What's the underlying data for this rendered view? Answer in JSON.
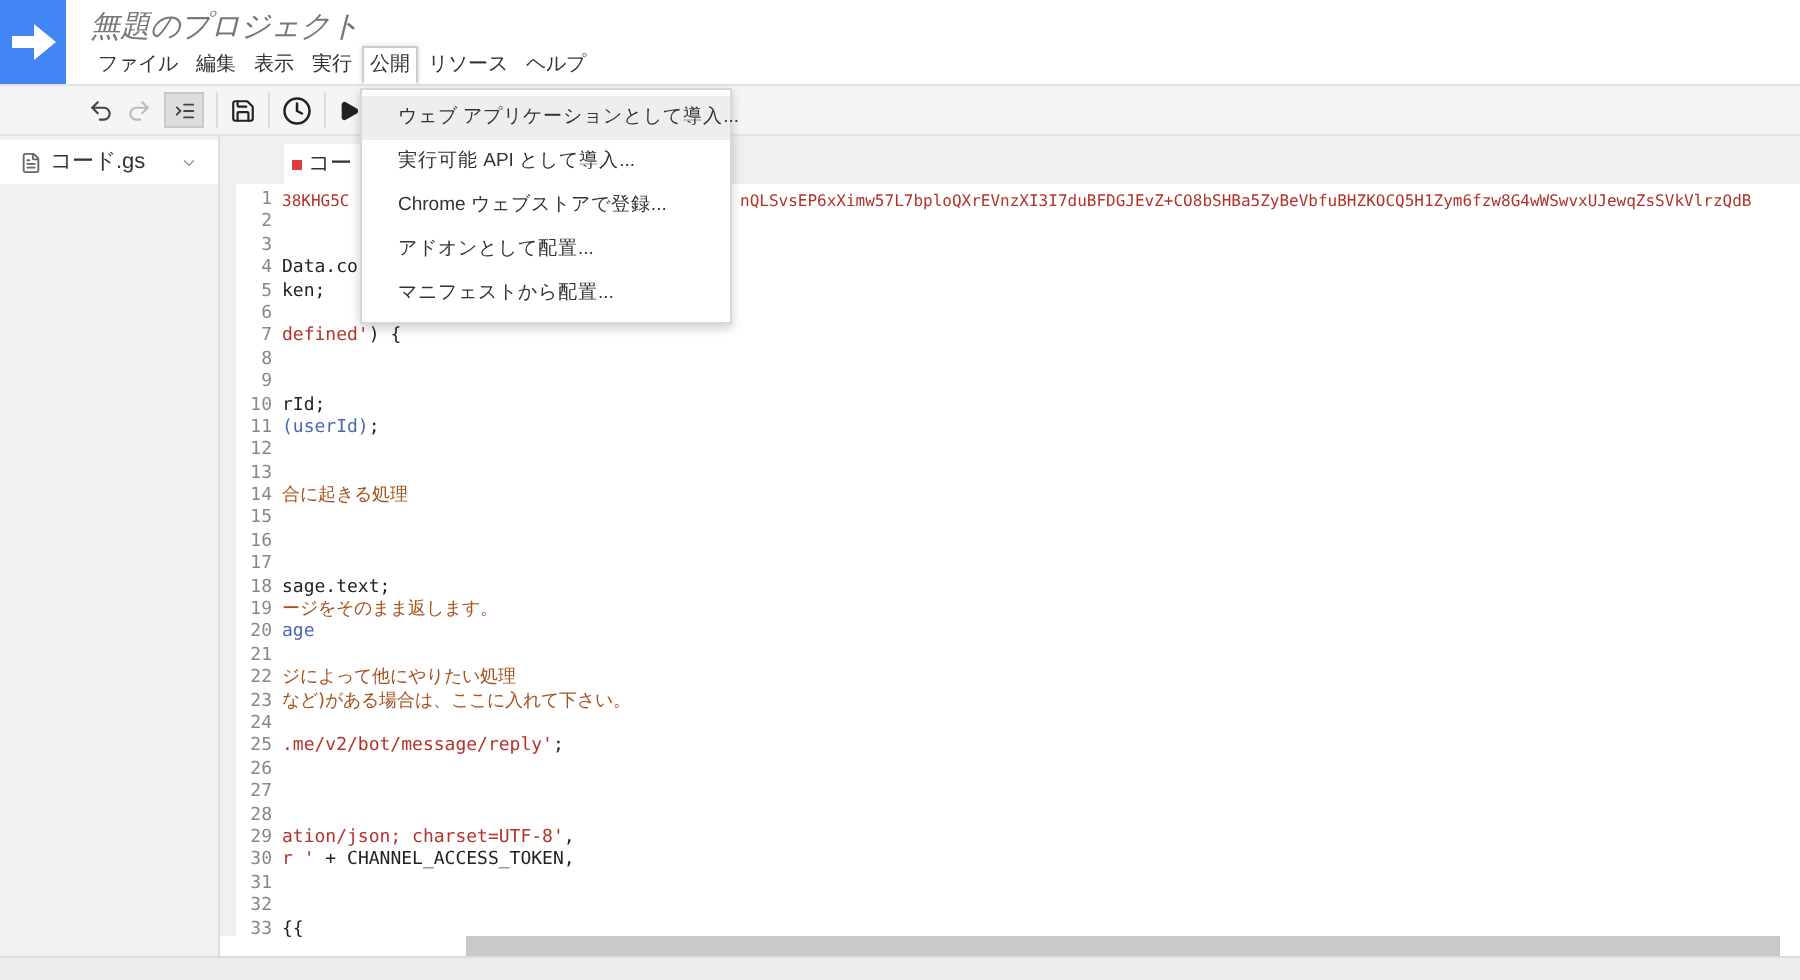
{
  "project": {
    "title": "無題のプロジェクト"
  },
  "menubar": [
    {
      "label": "ファイル",
      "selected": false
    },
    {
      "label": "編集",
      "selected": false
    },
    {
      "label": "表示",
      "selected": false
    },
    {
      "label": "実行",
      "selected": false
    },
    {
      "label": "公開",
      "selected": true
    },
    {
      "label": "リソース",
      "selected": false
    },
    {
      "label": "ヘルプ",
      "selected": false
    }
  ],
  "menu": [
    {
      "label": "ウェブ アプリケーションとして導入...",
      "selected": true
    },
    {
      "label": "実行可能 API として導入...",
      "selected": false
    },
    {
      "label": "Chrome ウェブストアで登録...",
      "selected": false
    },
    {
      "label": "アドオンとして配置...",
      "selected": false
    },
    {
      "label": "マニフェストから配置...",
      "selected": false
    }
  ],
  "sidebar": {
    "items": [
      {
        "label": "コード.gs",
        "selected": true
      }
    ]
  },
  "tab": {
    "label": "コー",
    "unsaved": true
  },
  "code": [
    {
      "number": "1",
      "segments": [
        {
          "text": "38KHG5C",
          "kind": "string"
        }
      ],
      "after_menu": [
        {
          "text": "nQLSvsEP6xXimw57L7bploQXrEVnzXI3I7duBFDGJEvZ+CO8bSHBa5ZyBeVbfuBHZKOCQ5H1Zym6fzw8G4wWSwvxUJewqZsSVkVlrzQdB",
          "kind": "string"
        }
      ]
    },
    {
      "number": "2"
    },
    {
      "number": "3"
    },
    {
      "number": "4",
      "segments": [
        {
          "text": "Data.co",
          "kind": "plain"
        }
      ]
    },
    {
      "number": "5",
      "segments": [
        {
          "text": "ken;",
          "kind": "plain"
        }
      ]
    },
    {
      "number": "6"
    },
    {
      "number": "7",
      "segments": [
        {
          "text": "defined'",
          "kind": "string"
        },
        {
          "text": ") {",
          "kind": "plain"
        }
      ]
    },
    {
      "number": "8"
    },
    {
      "number": "9"
    },
    {
      "number": "10",
      "segments": [
        {
          "text": "rId;",
          "kind": "plain"
        }
      ]
    },
    {
      "number": "11",
      "segments": [
        {
          "text": "(userId)",
          "kind": "variable"
        },
        {
          "text": ";",
          "kind": "plain"
        }
      ]
    },
    {
      "number": "12"
    },
    {
      "number": "13"
    },
    {
      "number": "14",
      "segments": [
        {
          "text": "合に起きる処理",
          "kind": "comment"
        }
      ]
    },
    {
      "number": "15"
    },
    {
      "number": "16"
    },
    {
      "number": "17"
    },
    {
      "number": "18",
      "segments": [
        {
          "text": "sage.text;",
          "kind": "plain"
        }
      ]
    },
    {
      "number": "19",
      "segments": [
        {
          "text": "ージをそのまま返します。",
          "kind": "comment"
        }
      ]
    },
    {
      "number": "20",
      "segments": [
        {
          "text": "age",
          "kind": "variable"
        }
      ]
    },
    {
      "number": "21"
    },
    {
      "number": "22",
      "segments": [
        {
          "text": "ジによって他にやりたい処理",
          "kind": "comment"
        }
      ]
    },
    {
      "number": "23",
      "segments": [
        {
          "text": "など)がある場合は、ここに入れて下さい。",
          "kind": "comment"
        }
      ]
    },
    {
      "number": "24"
    },
    {
      "number": "25",
      "segments": [
        {
          "text": ".me/v2/bot/message/reply'",
          "kind": "string"
        },
        {
          "text": ";",
          "kind": "plain"
        }
      ]
    },
    {
      "number": "26"
    },
    {
      "number": "27"
    },
    {
      "number": "28"
    },
    {
      "number": "29",
      "segments": [
        {
          "text": "ation/json; charset=UTF-8'",
          "kind": "string"
        },
        {
          "text": ",",
          "kind": "plain"
        }
      ]
    },
    {
      "number": "30",
      "segments": [
        {
          "text": "r '",
          "kind": "string"
        },
        {
          "text": " + CHANNEL_ACCESS_TOKEN,",
          "kind": "plain"
        }
      ]
    },
    {
      "number": "31"
    },
    {
      "number": "32"
    },
    {
      "number": "33",
      "segments": [
        {
          "text": "{{",
          "kind": "plain"
        }
      ]
    }
  ]
}
